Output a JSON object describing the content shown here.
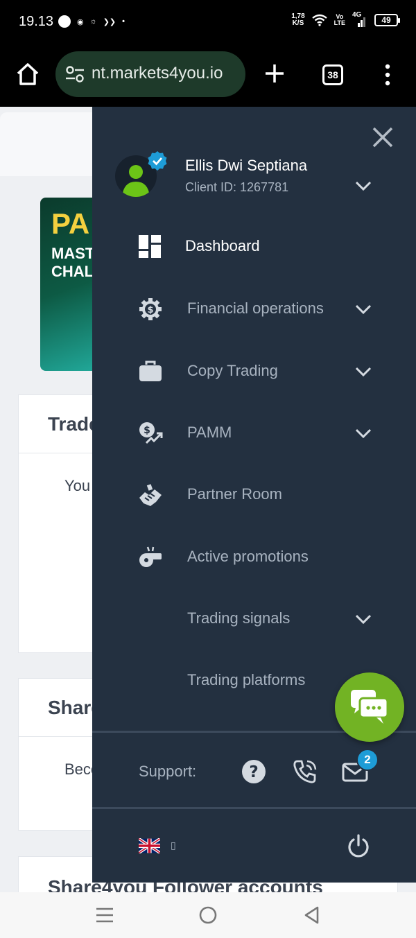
{
  "status_bar": {
    "time": "19.13",
    "net_speed_value": "1,78",
    "net_speed_unit": "K/S",
    "volte_top": "Vo",
    "volte_bottom": "LTE",
    "network": "4G",
    "battery": "49"
  },
  "browser": {
    "url": "nt.markets4you.io",
    "tab_count": "38"
  },
  "page_behind": {
    "banner_line1": "PA",
    "banner_line2": "MAST",
    "banner_line3": "CHAL",
    "card1_title": "Trade",
    "card1_text": "You",
    "card2_title": "Share",
    "card2_text": "Beco",
    "card3_title": "Share4you Follower accounts"
  },
  "drawer": {
    "user_name": "Ellis Dwi Septiana",
    "client_id": "Client ID: 1267781",
    "menu": [
      {
        "label": "Dashboard",
        "icon": "dashboard-icon",
        "has_chevron": false,
        "active": true
      },
      {
        "label": "Financial operations",
        "icon": "gear-dollar-icon",
        "has_chevron": true
      },
      {
        "label": "Copy Trading",
        "icon": "briefcase-icon",
        "has_chevron": true
      },
      {
        "label": "PAMM",
        "icon": "money-chart-icon",
        "has_chevron": true
      },
      {
        "label": "Partner Room",
        "icon": "handshake-icon",
        "has_chevron": false
      },
      {
        "label": "Active promotions",
        "icon": "whistle-icon",
        "has_chevron": false
      },
      {
        "label": "Trading signals",
        "icon": "",
        "has_chevron": true
      },
      {
        "label": "Trading platforms",
        "icon": "",
        "has_chevron": false
      }
    ],
    "support_label": "Support:",
    "mail_badge": "2",
    "language_label": "▯"
  },
  "colors": {
    "drawer_bg": "#233040",
    "accent_green": "#72b324",
    "badge_blue": "#1e9cd7",
    "menu_text": "#a8b3c0"
  }
}
